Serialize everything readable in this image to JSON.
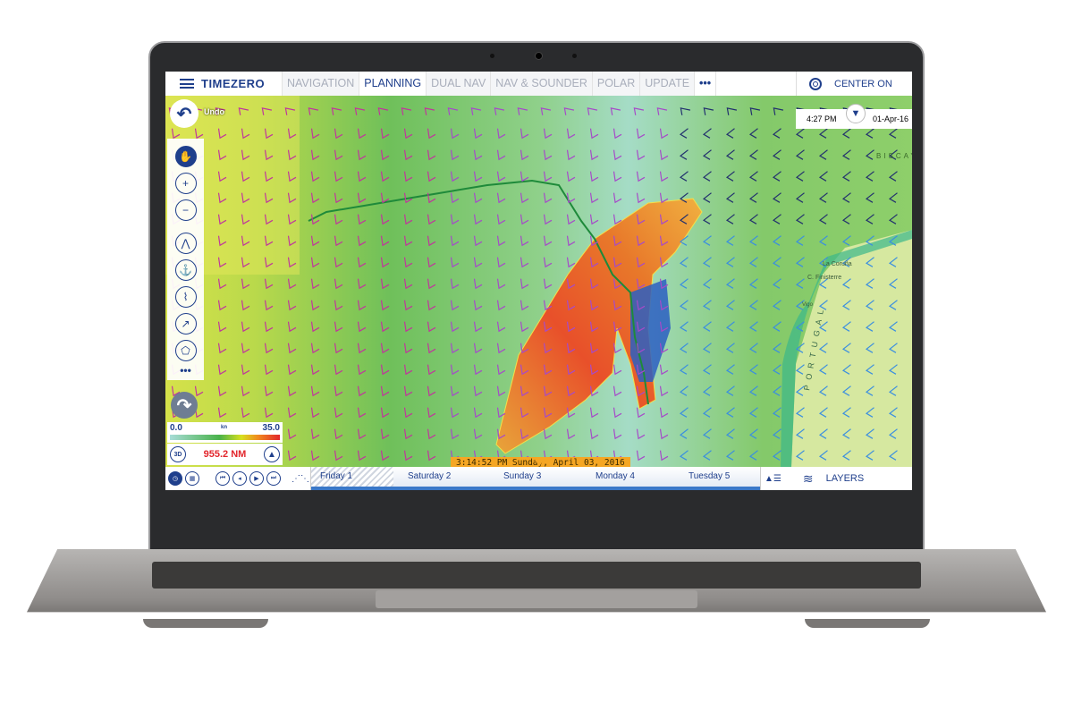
{
  "app": {
    "logo": "TIMEZERO"
  },
  "tabs": [
    {
      "label": "NAVIGATION",
      "active": false
    },
    {
      "label": "PLANNING",
      "active": true
    },
    {
      "label": "DUAL NAV",
      "active": false
    },
    {
      "label": "NAV & SOUNDER",
      "active": false
    },
    {
      "label": "POLAR",
      "active": false
    },
    {
      "label": "UPDATE",
      "active": false
    },
    {
      "label": "•••",
      "active": false
    }
  ],
  "center_on": {
    "label": "CENTER ON",
    "icon": "target-icon"
  },
  "clock": {
    "time": "4:27 PM",
    "date": "01-Apr-16"
  },
  "undo": {
    "label": "Undo"
  },
  "tools": [
    {
      "icon": "hand-pan-icon"
    },
    {
      "icon": "zoom-in-icon"
    },
    {
      "icon": "zoom-out-icon"
    },
    {
      "icon": "compass-dividers-icon"
    },
    {
      "icon": "buoy-marker-icon"
    },
    {
      "icon": "route-icon"
    },
    {
      "icon": "track-icon"
    },
    {
      "icon": "polygon-area-icon"
    },
    {
      "icon": "more-icon"
    }
  ],
  "legend": {
    "min": "0.0",
    "unit": "kn",
    "max": "35.0"
  },
  "distance": {
    "value": "955.2 NM",
    "color": "#e2262c",
    "mode_3d": "3D"
  },
  "timeline": {
    "current": "3:14:52 PM Sunday, April 03, 2016",
    "days": [
      "Friday 1",
      "Saturday 2",
      "Sunday 3",
      "Monday 4",
      "Tuesday 5"
    ]
  },
  "layers": {
    "label": "LAYERS"
  },
  "map_labels": {
    "bay": "BISCAY",
    "city1": "La Coruña",
    "city2": "C. Finisterre",
    "city3": "Vigo",
    "country": "PORTUGAL"
  },
  "colors": {
    "accent": "#1f3f8c",
    "timeline_marker": "#f5a623"
  }
}
